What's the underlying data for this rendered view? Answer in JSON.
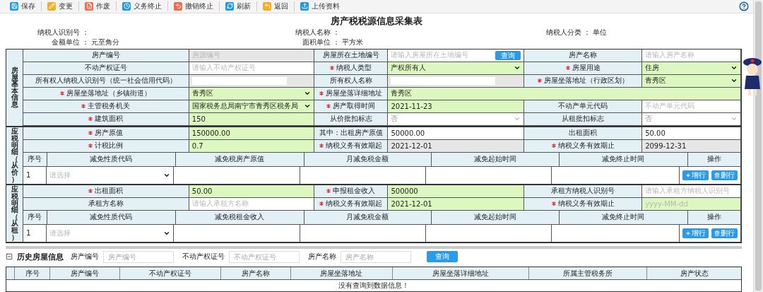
{
  "toolbar": [
    {
      "label": "保存",
      "kind": "save",
      "color": "#1e9be0"
    },
    {
      "label": "变更",
      "kind": "edit",
      "color": "#f2b01e"
    },
    {
      "label": "作废",
      "kind": "void",
      "color": "#ef6b4a"
    },
    {
      "label": "义务终止",
      "kind": "stop",
      "color": "#1e9be0"
    },
    {
      "label": "撤销终止",
      "kind": "undo",
      "color": "#ef6b4a"
    },
    {
      "label": "刷新",
      "kind": "refresh",
      "color": "#1e9be0"
    },
    {
      "label": "返回",
      "kind": "back",
      "color": "#f2b01e"
    },
    {
      "label": "上传资料",
      "kind": "upload",
      "color": "#1e9be0"
    }
  ],
  "title": "房产税税源信息采集表",
  "header_info": [
    {
      "label": "纳税人识别号 ："
    },
    {
      "label": "纳税人名称 ："
    },
    {
      "label": "纳税人分类 ：",
      "value": "单位"
    },
    {
      "label": "金额单位 ：",
      "value": "元至角分"
    },
    {
      "label": "面积单位 ：",
      "value": "平方米"
    }
  ],
  "sections": [
    {
      "title": "房屋基本信息",
      "rows": [
        {
          "kind": "fields",
          "cells": [
            {
              "label": "房产编号",
              "required": false,
              "field": {
                "kind": "text",
                "placeholder": "房源编号",
                "highlighted": false,
                "shaded": true
              }
            },
            {
              "label": "房屋所在土地编号",
              "required": false,
              "field": {
                "kind": "lookup",
                "placeholder": "请输入房屋所在土地编号",
                "button": "查询",
                "highlighted": false,
                "shaded": false
              }
            },
            {
              "label": "房产名称",
              "required": false,
              "field": {
                "kind": "text",
                "placeholder": "请输入房产名称",
                "highlighted": false,
                "shaded": false
              }
            }
          ]
        },
        {
          "kind": "fields",
          "cells": [
            {
              "label": "不动产权证号",
              "required": false,
              "field": {
                "kind": "text",
                "placeholder": "请输入不动产权证号",
                "highlighted": false,
                "shaded": false
              }
            },
            {
              "label": "纳税人类型",
              "required": true,
              "field": {
                "kind": "select",
                "value": "产权所有人",
                "highlighted": true,
                "shaded": false,
                "disabled": false
              }
            },
            {
              "label": "房屋用途",
              "required": true,
              "field": {
                "kind": "select",
                "value": "住房",
                "highlighted": true,
                "shaded": false,
                "disabled": false
              }
            }
          ]
        },
        {
          "kind": "fields",
          "cells": [
            {
              "label": "所有权人纳税人识别号（统一社会信用代码）",
              "required": false,
              "field": {
                "kind": "inset",
                "highlighted": false,
                "shaded": true
              }
            },
            {
              "label": "所有权人名称",
              "required": false,
              "field": {
                "kind": "inset",
                "highlighted": false,
                "shaded": true
              }
            },
            {
              "label": "房屋坐落地址（行政区划）",
              "required": true,
              "field": {
                "kind": "select",
                "value": "青秀区",
                "highlighted": true,
                "shaded": false,
                "disabled": false
              }
            }
          ]
        },
        {
          "kind": "fields",
          "cells": [
            {
              "label": "房屋坐落地址（乡镇街道）",
              "required": true,
              "field": {
                "kind": "select",
                "value": "青秀区",
                "highlighted": true,
                "shaded": false,
                "disabled": false
              }
            },
            {
              "label": "房屋坐落详细地址",
              "required": true,
              "field": {
                "kind": "text",
                "value": "青秀区",
                "highlighted": true,
                "shaded": false
              }
            }
          ]
        },
        {
          "kind": "fields",
          "cells": [
            {
              "label": "主管税务机关",
              "required": true,
              "field": {
                "kind": "select",
                "value": "国家税务总局南宁市青秀区税务局",
                "highlighted": true,
                "shaded": false,
                "disabled": false
              }
            },
            {
              "label": "房产取得时间",
              "required": true,
              "field": {
                "kind": "text",
                "value": "2021-11-23",
                "highlighted": true,
                "shaded": false
              }
            },
            {
              "label": "不动产单元代码",
              "required": false,
              "field": {
                "kind": "text",
                "placeholder": "不动产单元代码",
                "highlighted": false,
                "shaded": false
              }
            }
          ]
        },
        {
          "kind": "fields",
          "cells": [
            {
              "label": "建筑面积",
              "required": true,
              "field": {
                "kind": "text",
                "value": "150",
                "highlighted": true,
                "shaded": false
              }
            },
            {
              "label": "从价批扣标志",
              "required": false,
              "field": {
                "kind": "select",
                "value": "否",
                "highlighted": false,
                "shaded": false,
                "disabled": true
              }
            },
            {
              "label": "从租批扣标志",
              "required": false,
              "field": {
                "kind": "select",
                "value": "否",
                "highlighted": false,
                "shaded": false,
                "disabled": true
              }
            }
          ]
        }
      ]
    },
    {
      "title": "应税明细（从价）",
      "rows": [
        {
          "kind": "fields",
          "cells": [
            {
              "label": "房产原值",
              "required": true,
              "field": {
                "kind": "text",
                "value": "150000.00",
                "highlighted": true,
                "shaded": false
              }
            },
            {
              "label": "其中：出租房产原值",
              "required": false,
              "field": {
                "kind": "text",
                "value": "50000.00",
                "highlighted": false,
                "shaded": false
              }
            },
            {
              "label": "出租面积",
              "required": false,
              "field": {
                "kind": "text",
                "value": "50.00",
                "highlighted": false,
                "shaded": false
              }
            }
          ]
        },
        {
          "kind": "fields",
          "cells": [
            {
              "label": "计税比例",
              "required": true,
              "field": {
                "kind": "text",
                "value": "0.7",
                "highlighted": true,
                "shaded": false
              }
            },
            {
              "label": "纳税义务有效期起",
              "required": true,
              "field": {
                "kind": "text",
                "value": "2021-12-01",
                "highlighted": false,
                "shaded": true
              }
            },
            {
              "label": "纳税义务有效期止",
              "required": true,
              "field": {
                "kind": "text",
                "value": "2099-12-31",
                "highlighted": false,
                "shaded": true
              }
            }
          ]
        },
        {
          "kind": "grid-head",
          "columns": [
            "序号",
            "减免性质代码",
            "减免税房产原值",
            "月减免税金额",
            "减免起始时间",
            "减免终止时间",
            "操作"
          ]
        },
        {
          "kind": "grid-row",
          "cells": [
            {
              "kind": "text",
              "value": "1"
            },
            {
              "kind": "select",
              "placeholder": "请选择"
            },
            {
              "kind": "blank"
            },
            {
              "kind": "blank"
            },
            {
              "kind": "blank"
            },
            {
              "kind": "blank"
            },
            {
              "kind": "actions",
              "buttons": [
                {
                  "label": "增行",
                  "kind": "add"
                },
                {
                  "label": "删行",
                  "kind": "delete"
                }
              ]
            }
          ]
        }
      ]
    },
    {
      "title": "应税明细（从租）",
      "rows": [
        {
          "kind": "fields",
          "cells": [
            {
              "label": "出租面积",
              "required": true,
              "field": {
                "kind": "text",
                "value": "50.00",
                "highlighted": true,
                "shaded": false
              }
            },
            {
              "label": "申报租金收入",
              "required": true,
              "field": {
                "kind": "text",
                "value": "500000",
                "highlighted": true,
                "shaded": false
              }
            },
            {
              "label": "承租方纳税人识别号",
              "required": false,
              "field": {
                "kind": "text",
                "placeholder": "请输入承租方纳税人识别号",
                "highlighted": false,
                "shaded": false
              }
            }
          ]
        },
        {
          "kind": "fields",
          "cells": [
            {
              "label": "承租方名称",
              "required": false,
              "field": {
                "kind": "text",
                "placeholder": "请输入承租方名称",
                "highlighted": false,
                "shaded": false
              }
            },
            {
              "label": "纳税义务有效期起",
              "required": true,
              "field": {
                "kind": "text",
                "value": "2021-12-01",
                "highlighted": true,
                "shaded": false
              }
            },
            {
              "label": "纳税义务有效期止",
              "required": true,
              "field": {
                "kind": "text",
                "placeholder": "yyyy-MM-dd",
                "highlighted": true,
                "shaded": false
              }
            }
          ]
        },
        {
          "kind": "grid-head",
          "columns": [
            "序号",
            "减免性质代码",
            "减免税租金收入",
            "月减免税金额",
            "减免起始时间",
            "减免终止时间",
            "操作"
          ]
        },
        {
          "kind": "grid-row",
          "cells": [
            {
              "kind": "text",
              "value": "1"
            },
            {
              "kind": "select",
              "placeholder": "请选择"
            },
            {
              "kind": "blank"
            },
            {
              "kind": "blank"
            },
            {
              "kind": "blank"
            },
            {
              "kind": "blank"
            },
            {
              "kind": "actions",
              "buttons": [
                {
                  "label": "增行",
                  "kind": "add"
                },
                {
                  "label": "删行",
                  "kind": "delete"
                }
              ]
            }
          ]
        }
      ]
    }
  ],
  "history": {
    "title": "历史房屋信息",
    "expanded": true,
    "filters": [
      {
        "label": "房产编号",
        "placeholder": "房产编号"
      },
      {
        "label": "不动产权证号",
        "placeholder": "不动产权证号"
      },
      {
        "label": "房产名称",
        "placeholder": "房产名称"
      }
    ],
    "search_button": "查询",
    "columns": [
      "序号",
      "房产编号",
      "不动产权证号",
      "房产名称",
      "房屋坐落地址",
      "房屋坐落详细地址",
      "所属主管税务所",
      "房产状态"
    ],
    "empty_message": "没有查询到数据信息！"
  }
}
